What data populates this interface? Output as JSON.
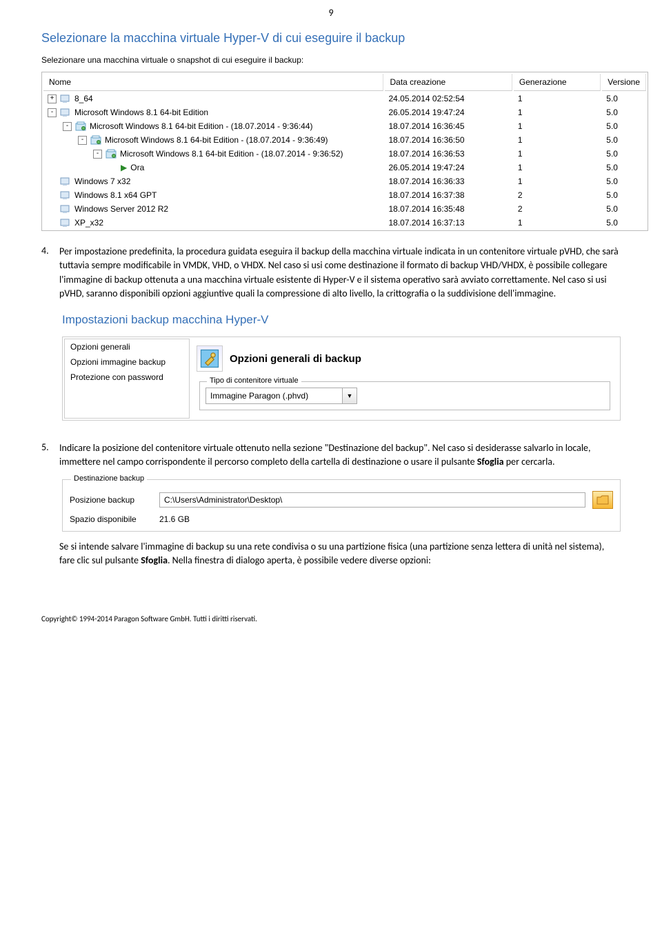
{
  "page_number": "9",
  "section1_heading": "Selezionare la macchina virtuale Hyper-V di cui eseguire il backup",
  "section1_instruction": "Selezionare una macchina virtuale o snapshot di cui eseguire il backup:",
  "vm_table": {
    "headers": {
      "name": "Nome",
      "date": "Data creazione",
      "gen": "Generazione",
      "ver": "Versione"
    },
    "rows": [
      {
        "indent": 0,
        "exp": "+",
        "icon": "vm",
        "label": "8_64",
        "date": "24.05.2014 02:52:54",
        "gen": "1",
        "ver": "5.0"
      },
      {
        "indent": 0,
        "exp": "-",
        "icon": "vm",
        "label": "Microsoft Windows 8.1 64-bit Edition",
        "date": "26.05.2014 19:47:24",
        "gen": "1",
        "ver": "5.0"
      },
      {
        "indent": 1,
        "exp": "-",
        "icon": "snap",
        "label": "Microsoft Windows 8.1 64-bit Edition - (18.07.2014 - 9:36:44)",
        "date": "18.07.2014 16:36:45",
        "gen": "1",
        "ver": "5.0"
      },
      {
        "indent": 2,
        "exp": "-",
        "icon": "snap",
        "label": "Microsoft Windows 8.1 64-bit Edition - (18.07.2014 - 9:36:49)",
        "date": "18.07.2014 16:36:50",
        "gen": "1",
        "ver": "5.0"
      },
      {
        "indent": 3,
        "exp": "-",
        "icon": "snap",
        "label": "Microsoft Windows 8.1 64-bit Edition - (18.07.2014 - 9:36:52)",
        "date": "18.07.2014 16:36:53",
        "gen": "1",
        "ver": "5.0"
      },
      {
        "indent": 4,
        "exp": "",
        "icon": "now",
        "label": "Ora",
        "date": "26.05.2014 19:47:24",
        "gen": "1",
        "ver": "5.0"
      },
      {
        "indent": 0,
        "exp": "",
        "icon": "vm",
        "label": "Windows 7 x32",
        "date": "18.07.2014 16:36:33",
        "gen": "1",
        "ver": "5.0"
      },
      {
        "indent": 0,
        "exp": "",
        "icon": "vm",
        "label": "Windows 8.1 x64 GPT",
        "date": "18.07.2014 16:37:38",
        "gen": "2",
        "ver": "5.0"
      },
      {
        "indent": 0,
        "exp": "",
        "icon": "vm",
        "label": "Windows Server 2012 R2",
        "date": "18.07.2014 16:35:48",
        "gen": "2",
        "ver": "5.0"
      },
      {
        "indent": 0,
        "exp": "",
        "icon": "vm",
        "label": "XP_x32",
        "date": "18.07.2014 16:37:13",
        "gen": "1",
        "ver": "5.0"
      }
    ]
  },
  "item4": {
    "num": "4.",
    "text": "Per impostazione predefinita, la procedura guidata eseguira il backup della macchina virtuale indicata in un contenitore virtuale pVHD, che sarà tuttavia sempre modificabile in VMDK, VHD, o VHDX. Nel caso si usi come destinazione il formato di backup VHD/VHDX, è possibile collegare l'immagine di backup ottenuta a una macchina virtuale esistente di Hyper-V e il sistema operativo sarà avviato correttamente. Nel caso si usi pVHD, saranno disponibili opzioni aggiuntive quali la compressione di alto livello, la crittografia o la suddivisione dell'immagine."
  },
  "section2_heading": "Impostazioni backup macchina Hyper-V",
  "options_panel": {
    "left_items": [
      "Opzioni generali",
      "Opzioni immagine backup",
      "Protezione con password"
    ],
    "right_title": "Opzioni generali di backup",
    "fieldset_label": "Tipo di contenitore virtuale",
    "select_value": "Immagine Paragon (.phvd)",
    "select_arrow": "▼"
  },
  "item5": {
    "num": "5.",
    "text_a": "Indicare la posizione del contenitore virtuale ottenuto nella sezione \"Destinazione del backup\". Nel caso si desiderasse salvarlo in locale, immettere nel campo corrispondente il percorso completo della cartella di destinazione o usare il pulsante ",
    "bold_a": "Sfoglia",
    "text_b": " per cercarla."
  },
  "dest_panel": {
    "legend": "Destinazione backup",
    "pos_label": "Posizione backup",
    "pos_value": "C:\\Users\\Administrator\\Desktop\\",
    "space_label": "Spazio disponibile",
    "space_value": "21.6 GB"
  },
  "para_after": {
    "a": "Se si intende salvare l'immagine di backup su una rete condivisa o su una partizione fisica (una partizione senza lettera di unità nel sistema), fare clic sul pulsante ",
    "bold": "Sfoglia",
    "b": ". Nella finestra di dialogo aperta, è possibile vedere diverse opzioni:"
  },
  "footer": "Copyright© 1994-2014 Paragon Software GmbH. Tutti i diritti riservati."
}
